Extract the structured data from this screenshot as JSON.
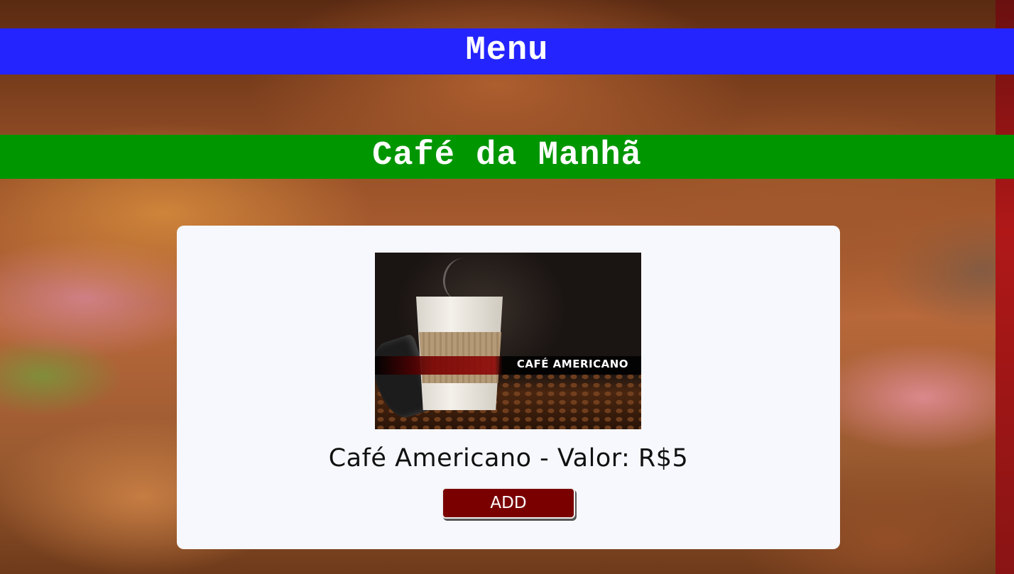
{
  "header": {
    "title": "Menu"
  },
  "section": {
    "title": "Café da Manhã"
  },
  "product": {
    "image_caption": "CAFÉ AMERICANO",
    "label": "Café Americano - Valor: R$5",
    "add_label": "ADD"
  },
  "colors": {
    "menu_banner": "#2424ff",
    "section_banner": "#009600",
    "card_background": "#f7f8fe",
    "add_button": "#7a0000"
  }
}
